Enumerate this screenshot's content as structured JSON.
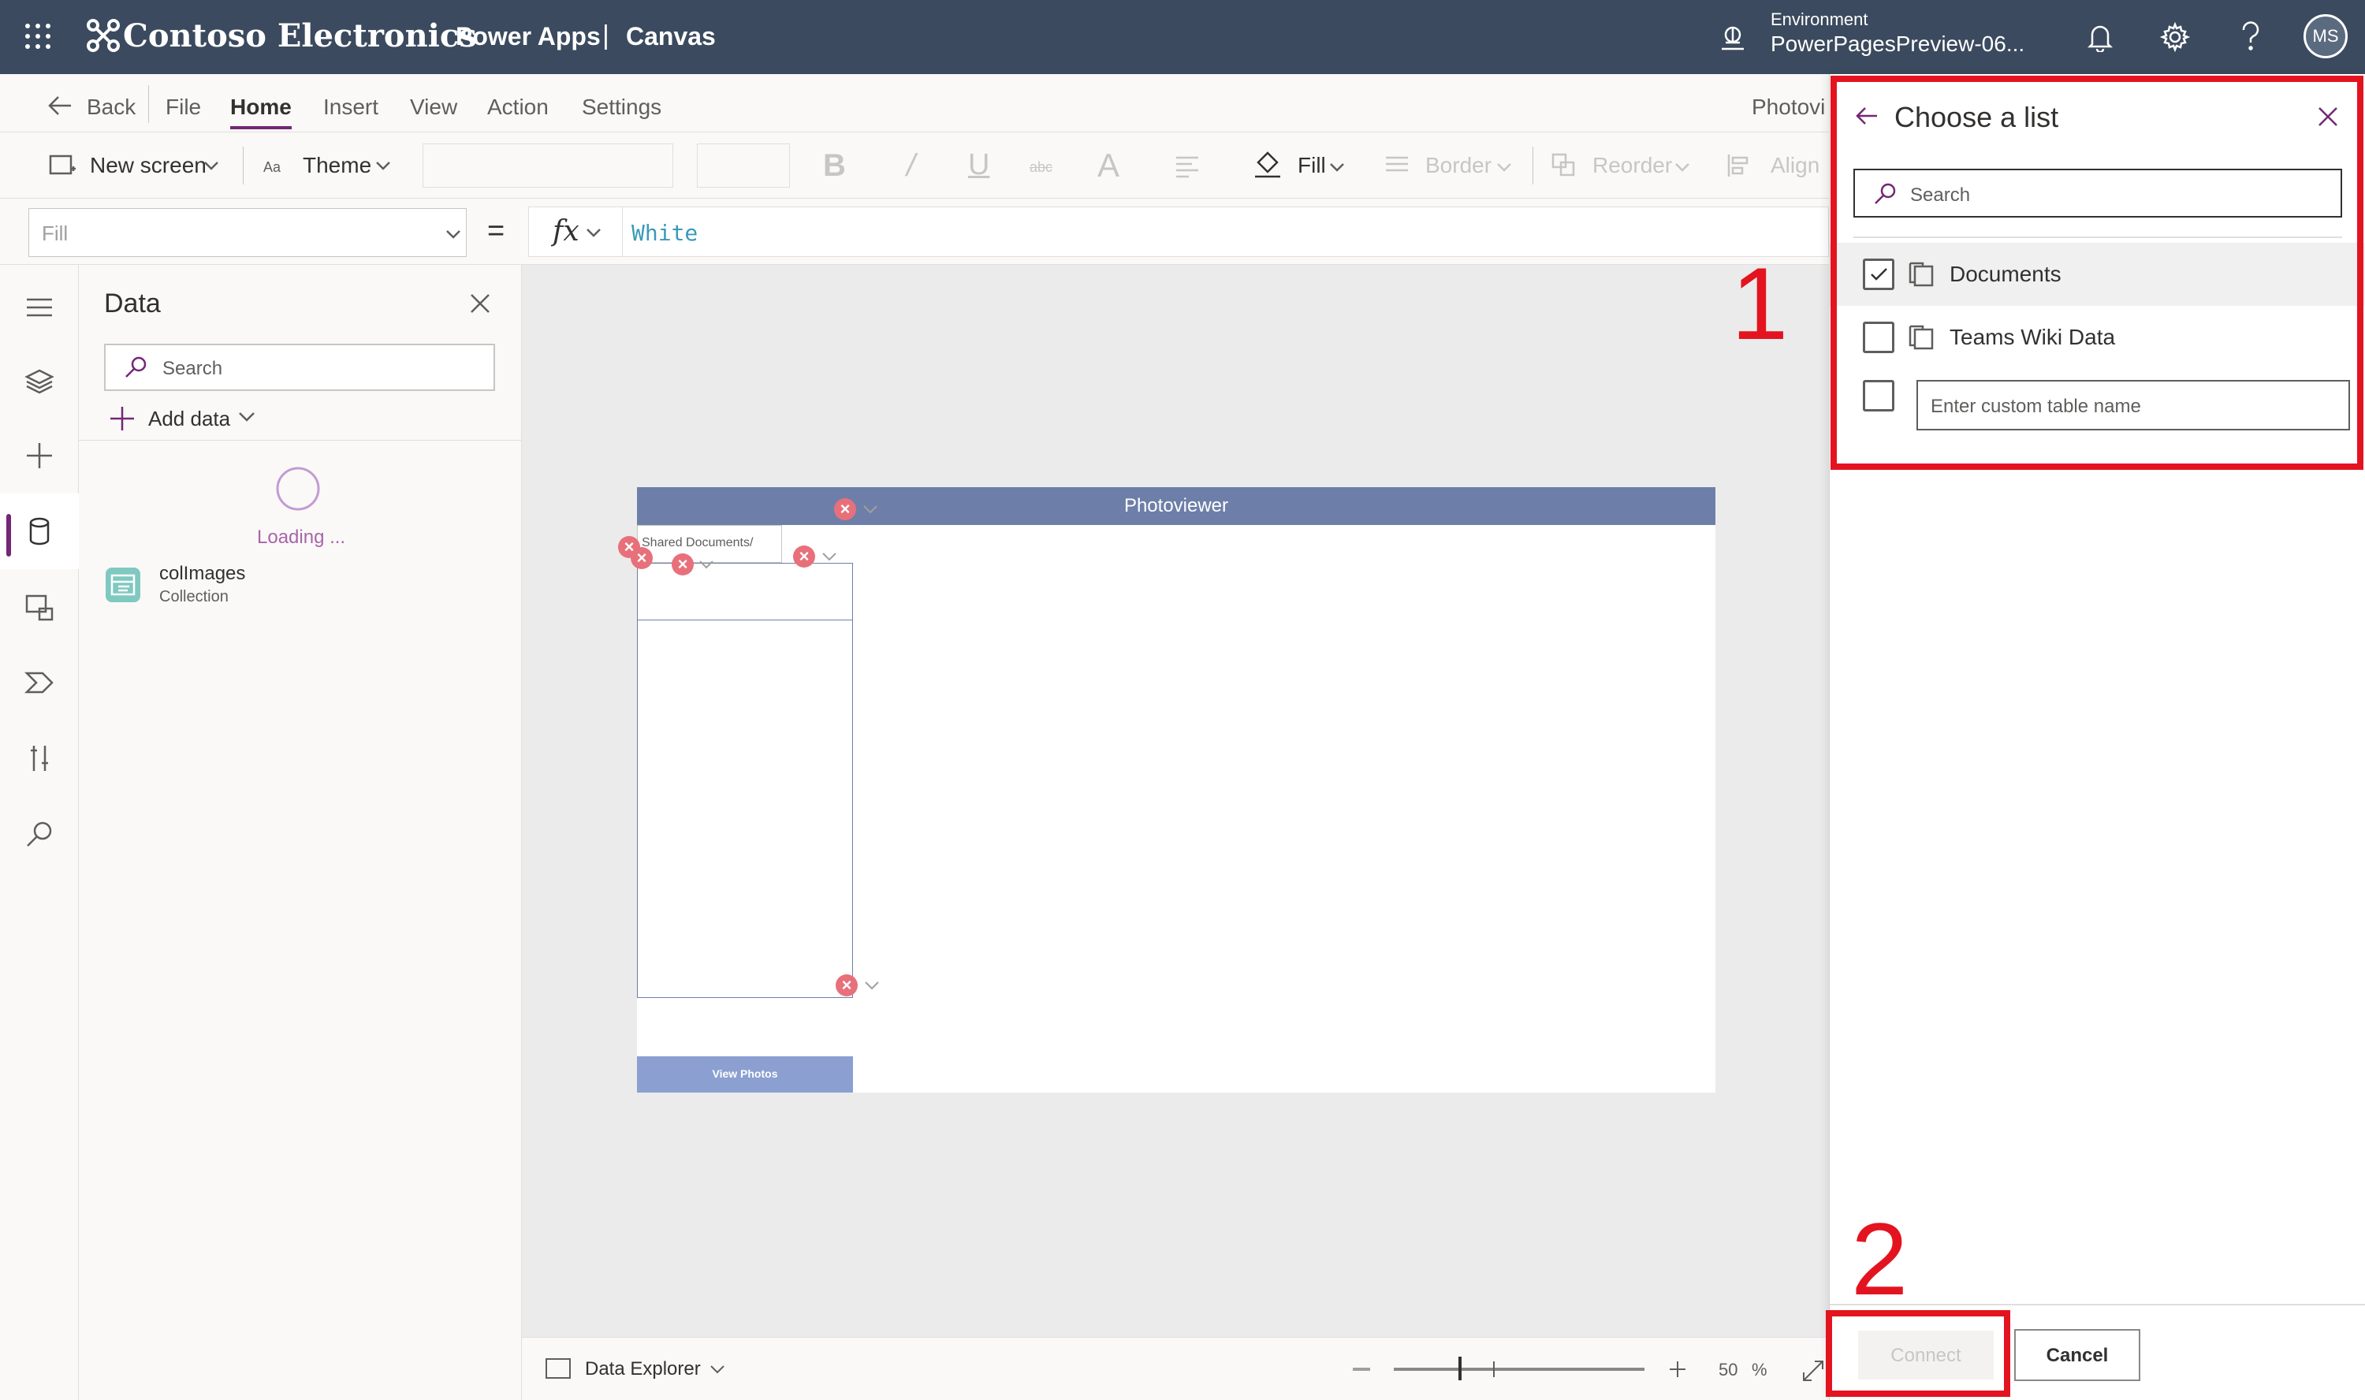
{
  "topbar": {
    "brand": "Contoso Electronics",
    "app": "Power Apps",
    "separator": "|",
    "mode": "Canvas",
    "env_label": "Environment",
    "env_name": "PowerPagesPreview-06...",
    "avatar": "MS"
  },
  "menu": {
    "back": "Back",
    "items": [
      "File",
      "Home",
      "Insert",
      "View",
      "Action",
      "Settings"
    ],
    "active": "Home",
    "app_name_truncated": "Photovi"
  },
  "toolbar": {
    "new_screen": "New screen",
    "theme": "Theme",
    "fill": "Fill",
    "border": "Border",
    "reorder": "Reorder",
    "align": "Align"
  },
  "formula": {
    "property": "Fill",
    "equals": "=",
    "fx": "fx",
    "value": "White"
  },
  "data_panel": {
    "title": "Data",
    "search_placeholder": "Search",
    "add_data": "Add data",
    "loading": "Loading ...",
    "items": [
      {
        "name": "colImages",
        "type": "Collection"
      }
    ]
  },
  "canvas": {
    "header_title": "Photoviewer",
    "dropdown_text": "Shared Documents/",
    "button_label": "View Photos"
  },
  "statusbar": {
    "data_explorer": "Data Explorer",
    "zoom_value": "50",
    "zoom_unit": "%"
  },
  "list_panel": {
    "title": "Choose a list",
    "search_placeholder": "Search",
    "lists": [
      {
        "name": "Documents",
        "checked": true
      },
      {
        "name": "Teams Wiki Data",
        "checked": false
      }
    ],
    "custom_placeholder": "Enter custom table name",
    "connect_label": "Connect",
    "cancel_label": "Cancel"
  },
  "annotations": [
    "1",
    "2"
  ],
  "colors": {
    "topbar": "#3b4a5e",
    "accent": "#742774",
    "annotation_red": "#e3141f",
    "header_bar": "#6d7fa8",
    "button_fill": "#8b9fd1"
  }
}
